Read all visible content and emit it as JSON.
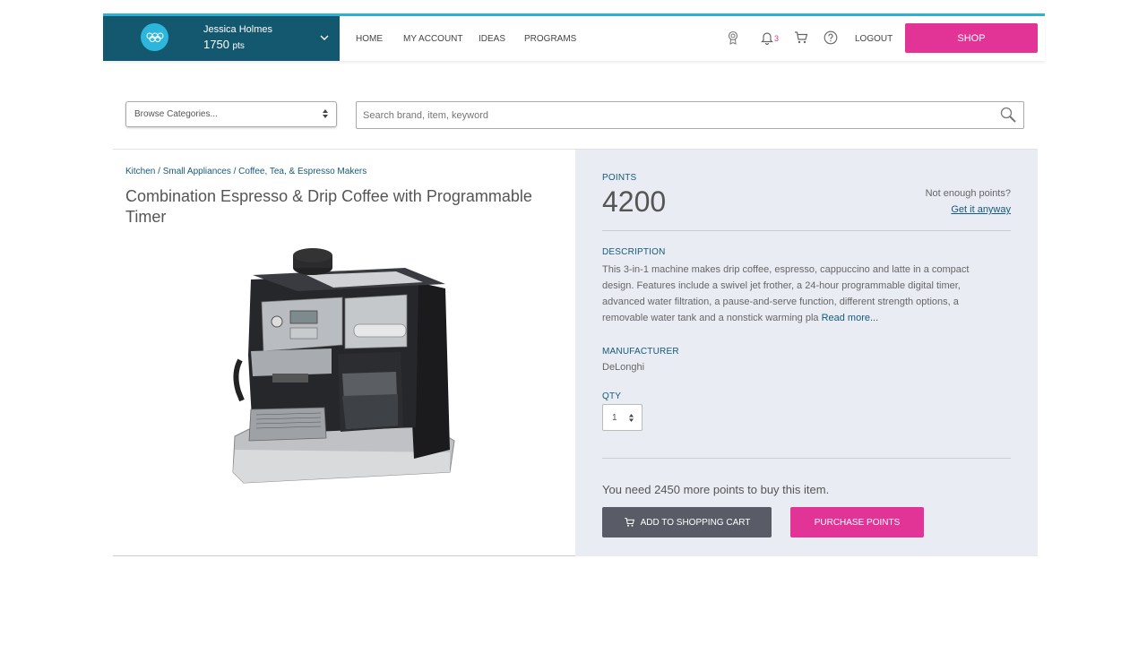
{
  "user": {
    "name": "Jessica Holmes",
    "points": "1750",
    "points_unit": "pts"
  },
  "nav": {
    "home": "HOME",
    "account": "MY ACCOUNT",
    "ideas": "IDEAS",
    "programs": "PROGRAMS"
  },
  "header": {
    "notification_count": "3",
    "logout": "LOGOUT",
    "shop": "SHOP"
  },
  "search": {
    "browse_label": "Browse Categories...",
    "placeholder": "Search brand, item, keyword"
  },
  "breadcrumb": "Kitchen / Small Appliances / Coffee, Tea, & Espresso Makers",
  "product": {
    "title": "Combination Espresso & Drip Coffee with Programmable Timer",
    "points_label": "POINTS",
    "points": "4200",
    "not_enough": "Not enough points?",
    "get_anyway": "Get it anyway",
    "description_label": "DESCRIPTION",
    "description": "This 3-in-1 machine makes drip coffee, espresso, cappuccino and latte in a compact design. Features include a swivel jet frother, a 24-hour programmable digital timer, advanced water filtration, a pause-and-serve function, different strength options, a removable water tank and a nonstick warming pla",
    "read_more": "Read more...",
    "manufacturer_label": "MANUFACTURER",
    "manufacturer": "DeLonghi",
    "qty_label": "QTY",
    "qty": "1",
    "need_more": "You need 2450 more points to buy this item.",
    "add_to_cart": "ADD TO SHOPPING CART",
    "purchase_points": "PURCHASE POINTS"
  },
  "colors": {
    "accent": "#e23497",
    "header_bg": "#13586f",
    "top_border": "#29b1d6",
    "link": "#155a7a"
  }
}
